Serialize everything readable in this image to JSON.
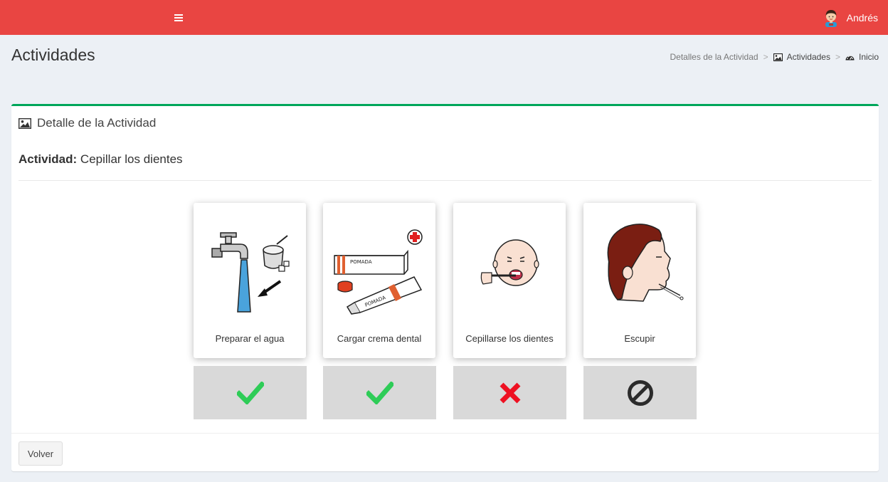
{
  "header": {
    "menu_icon": "hamburger-icon",
    "user_name": "Andrés",
    "avatar_icon": "user-avatar-icon",
    "brand_color": "#e94542"
  },
  "page": {
    "title": "Actividades"
  },
  "breadcrumb": {
    "items": [
      {
        "label": "Detalles de la Actividad",
        "icon": ""
      },
      {
        "label": "Actividades",
        "icon": "image-icon"
      },
      {
        "label": "Inicio",
        "icon": "dashboard-icon"
      }
    ],
    "separator": ">"
  },
  "box": {
    "title": "Detalle de la Actividad",
    "title_icon": "image-icon",
    "accent_color": "#00a65a",
    "activity_label": "Actividad:",
    "activity_name": "Cepillar los dientes"
  },
  "steps": [
    {
      "label": "Preparar el agua",
      "pictogram": "faucet-water-pictogram",
      "status": "completed",
      "status_icon": "check-icon"
    },
    {
      "label": "Cargar crema dental",
      "pictogram": "toothpaste-pictogram",
      "status": "completed",
      "status_icon": "check-icon"
    },
    {
      "label": "Cepillarse los dientes",
      "pictogram": "brushing-teeth-pictogram",
      "status": "failed",
      "status_icon": "cross-icon"
    },
    {
      "label": "Escupir",
      "pictogram": "spit-pictogram",
      "status": "not-done",
      "status_icon": "ban-icon"
    }
  ],
  "status_colors": {
    "completed": "#2ecc57",
    "failed": "#ee1122",
    "not-done": "#2b2b2b"
  },
  "footer": {
    "back_label": "Volver"
  }
}
